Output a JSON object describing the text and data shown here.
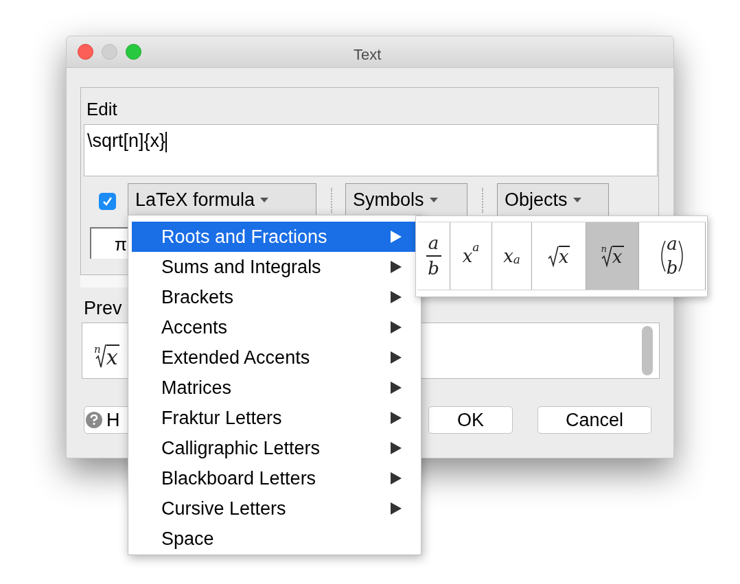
{
  "window": {
    "title": "Text"
  },
  "edit": {
    "label": "Edit",
    "value": "\\sqrt[n]{x}"
  },
  "toolbar": {
    "checkbox": {
      "checked": true
    },
    "menus": [
      {
        "label": "LaTeX formula"
      },
      {
        "label": "Symbols"
      },
      {
        "label": "Objects"
      }
    ]
  },
  "symbol_button": {
    "label": "π"
  },
  "preview": {
    "label": "Prev",
    "formula": {
      "kind": "nroot",
      "index": "n",
      "radicand": "x"
    }
  },
  "buttons": [
    {
      "kind": "help",
      "label": "H"
    },
    {
      "kind": "plain",
      "label": "OK"
    },
    {
      "kind": "plain",
      "label": "Cancel"
    }
  ],
  "menu": {
    "items": [
      {
        "label": "Roots and Fractions",
        "submenu": true,
        "selected": true
      },
      {
        "label": "Sums and Integrals",
        "submenu": true,
        "selected": false
      },
      {
        "label": "Brackets",
        "submenu": true,
        "selected": false
      },
      {
        "label": "Accents",
        "submenu": true,
        "selected": false
      },
      {
        "label": "Extended Accents",
        "submenu": true,
        "selected": false
      },
      {
        "label": "Matrices",
        "submenu": true,
        "selected": false
      },
      {
        "label": "Fraktur Letters",
        "submenu": true,
        "selected": false
      },
      {
        "label": "Calligraphic Letters",
        "submenu": true,
        "selected": false
      },
      {
        "label": "Blackboard Letters",
        "submenu": true,
        "selected": false
      },
      {
        "label": "Cursive Letters",
        "submenu": true,
        "selected": false
      },
      {
        "label": "Space",
        "submenu": false,
        "selected": false
      }
    ]
  },
  "submenu": {
    "cells": [
      {
        "kind": "fraction",
        "top": "a",
        "bottom": "b",
        "selected": false
      },
      {
        "kind": "sup",
        "base": "x",
        "script": "a",
        "selected": false
      },
      {
        "kind": "sub",
        "base": "x",
        "script": "a",
        "selected": false
      },
      {
        "kind": "sqrt",
        "radicand": "x",
        "selected": false
      },
      {
        "kind": "nroot",
        "index": "n",
        "radicand": "x",
        "selected": true
      },
      {
        "kind": "binom",
        "top": "a",
        "bottom": "b",
        "selected": false
      }
    ]
  }
}
